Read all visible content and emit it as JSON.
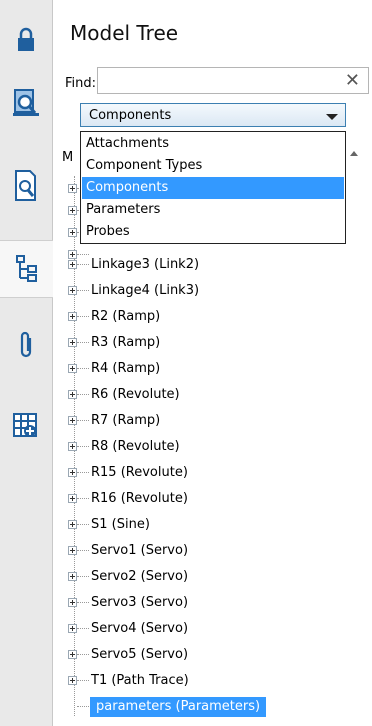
{
  "panel": {
    "title": "Model Tree"
  },
  "find": {
    "label": "Find:",
    "value": "",
    "clear": "✕"
  },
  "filter": {
    "selected": "Components",
    "options": [
      "Attachments",
      "Component Types",
      "Components",
      "Parameters",
      "Probes"
    ]
  },
  "tree": {
    "header": "M",
    "items": [
      "Linkage3 (Link2)",
      "Linkage4 (Link3)",
      "R2 (Ramp)",
      "R3 (Ramp)",
      "R4 (Ramp)",
      "R6 (Revolute)",
      "R7 (Ramp)",
      "R8 (Revolute)",
      "R15 (Revolute)",
      "R16 (Revolute)",
      "S1 (Sine)",
      "Servo1 (Servo)",
      "Servo2 (Servo)",
      "Servo3 (Servo)",
      "Servo4 (Servo)",
      "Servo5 (Servo)",
      "T1 (Path Trace)"
    ],
    "selected_item": "parameters (Parameters)"
  },
  "colors": {
    "selection": "#3399ff",
    "icon_blue": "#1f5f9e"
  },
  "rail_icons": [
    "lock-icon",
    "inspect-model-icon",
    "search-document-icon",
    "model-tree-icon",
    "attachment-icon",
    "table-plus-icon"
  ]
}
